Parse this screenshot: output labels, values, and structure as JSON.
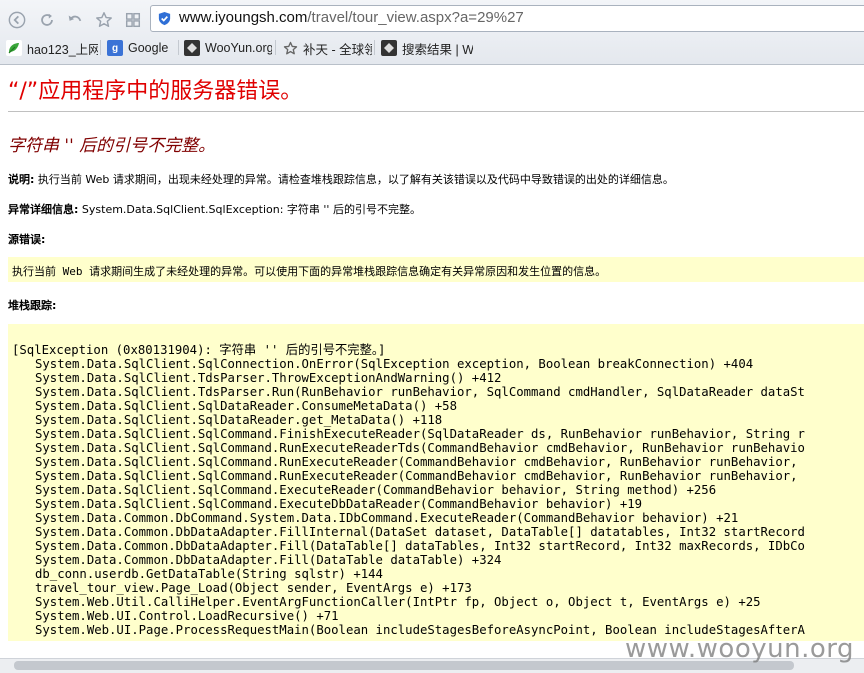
{
  "browser": {
    "address_bar": {
      "host": "www.iyoungsh.com",
      "path": "/travel/tour_view.aspx?a=29%27"
    },
    "bookmarks": [
      {
        "label": "hao123_上网",
        "icon": "hao123-icon",
        "color": "#2d8a2d"
      },
      {
        "label": "Google",
        "icon": "google-icon",
        "color": "#3b73d6"
      },
      {
        "label": "WooYun.org",
        "icon": "wooyun-icon",
        "color": "#333333"
      },
      {
        "label": "补天 - 全球领",
        "icon": "star-icon",
        "color": "#666666"
      },
      {
        "label": "搜索结果 | W",
        "icon": "wooyun-icon",
        "color": "#333333"
      }
    ]
  },
  "error_page": {
    "title": "“/”应用程序中的服务器错误。",
    "subtitle": "字符串 '' 后的引号不完整。",
    "description_label": "说明:",
    "description_text": " 执行当前 Web 请求期间，出现未经处理的异常。请检查堆栈跟踪信息，以了解有关该错误以及代码中导致错误的出处的详细信息。",
    "exception_label": "异常详细信息:",
    "exception_text": " System.Data.SqlClient.SqlException: 字符串 '' 后的引号不完整。",
    "source_label": "源错误:",
    "source_text": "执行当前 Web 请求期间生成了未经处理的异常。可以使用下面的异常堆栈跟踪信息确定有关异常原因和发生位置的信息。",
    "stack_label": "堆栈跟踪:",
    "stack_trace": [
      "[SqlException (0x80131904): 字符串 '' 后的引号不完整。]",
      "System.Data.SqlClient.SqlConnection.OnError(SqlException exception, Boolean breakConnection) +404",
      "System.Data.SqlClient.TdsParser.ThrowExceptionAndWarning() +412",
      "System.Data.SqlClient.TdsParser.Run(RunBehavior runBehavior, SqlCommand cmdHandler, SqlDataReader dataSt",
      "System.Data.SqlClient.SqlDataReader.ConsumeMetaData() +58",
      "System.Data.SqlClient.SqlDataReader.get_MetaData() +118",
      "System.Data.SqlClient.SqlCommand.FinishExecuteReader(SqlDataReader ds, RunBehavior runBehavior, String r",
      "System.Data.SqlClient.SqlCommand.RunExecuteReaderTds(CommandBehavior cmdBehavior, RunBehavior runBehavio",
      "System.Data.SqlClient.SqlCommand.RunExecuteReader(CommandBehavior cmdBehavior, RunBehavior runBehavior,",
      "System.Data.SqlClient.SqlCommand.RunExecuteReader(CommandBehavior cmdBehavior, RunBehavior runBehavior,",
      "System.Data.SqlClient.SqlCommand.ExecuteReader(CommandBehavior behavior, String method) +256",
      "System.Data.SqlClient.SqlCommand.ExecuteDbDataReader(CommandBehavior behavior) +19",
      "System.Data.Common.DbCommand.System.Data.IDbCommand.ExecuteReader(CommandBehavior behavior) +21",
      "System.Data.Common.DbDataAdapter.FillInternal(DataSet dataset, DataTable[] datatables, Int32 startRecord",
      "System.Data.Common.DbDataAdapter.Fill(DataTable[] dataTables, Int32 startRecord, Int32 maxRecords, IDbCo",
      "System.Data.Common.DbDataAdapter.Fill(DataTable dataTable) +324",
      "db_conn.userdb.GetDataTable(String sqlstr) +144",
      "travel_tour_view.Page_Load(Object sender, EventArgs e) +173",
      "System.Web.Util.CalliHelper.EventArgFunctionCaller(IntPtr fp, Object o, Object t, EventArgs e) +25",
      "System.Web.UI.Control.LoadRecursive() +71",
      "System.Web.UI.Page.ProcessRequestMain(Boolean includeStagesBeforeAsyncPoint, Boolean includeStagesAfterA"
    ]
  },
  "watermark": "www.wooyun.org",
  "colors": {
    "title_red": "#e00000",
    "subtitle_maroon": "#800000",
    "code_background": "#ffffcc"
  }
}
